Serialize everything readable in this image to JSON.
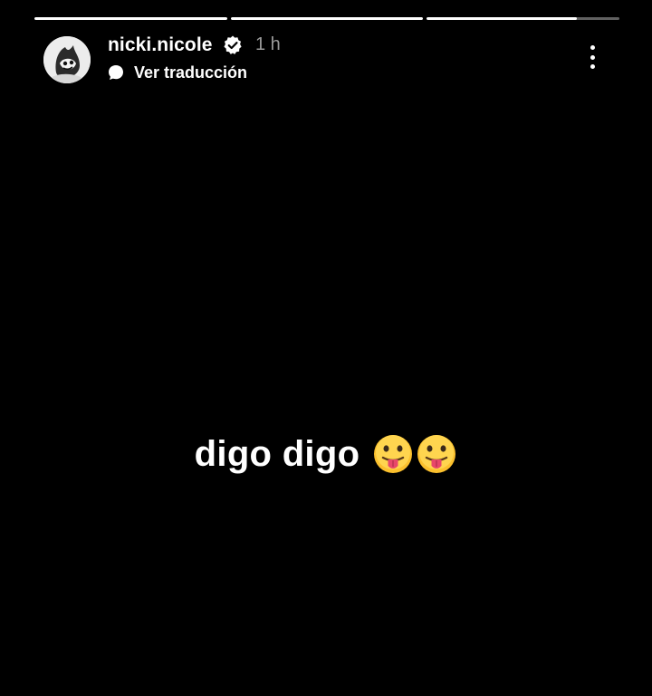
{
  "story": {
    "progress": [
      {
        "fill": 1.0
      },
      {
        "fill": 1.0
      },
      {
        "fill": 0.78
      }
    ],
    "header": {
      "username": "nicki.nicole",
      "time": "1 h",
      "translate_label": "Ver traducción",
      "avatar_icon": "avatar-illustration",
      "verified_icon": "verified-badge-icon",
      "translate_icon": "speech-bubble-icon",
      "more_icon": "more-vertical-icon"
    },
    "caption": {
      "text": "digo digo",
      "emoji": [
        "😛",
        "😛"
      ]
    }
  }
}
